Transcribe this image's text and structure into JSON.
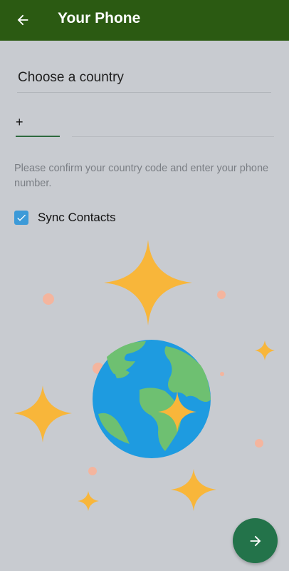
{
  "appbar": {
    "title": "Your Phone",
    "back_icon": "arrow-left-icon",
    "color": "#2b5a12"
  },
  "form": {
    "country_label": "Choose a country",
    "code_prefix": "+",
    "hint": "Please confirm your country code and enter your phone number.",
    "sync_contacts_label": "Sync Contacts",
    "sync_contacts_checked": true
  },
  "fab": {
    "icon": "arrow-right-icon",
    "color": "#23734a"
  },
  "colors": {
    "background": "#c8cbd0",
    "checkbox": "#3c9ad8",
    "star": "#f8b63a",
    "ocean": "#1e9be0",
    "land": "#6ec071",
    "dot": "#f4b59e"
  }
}
